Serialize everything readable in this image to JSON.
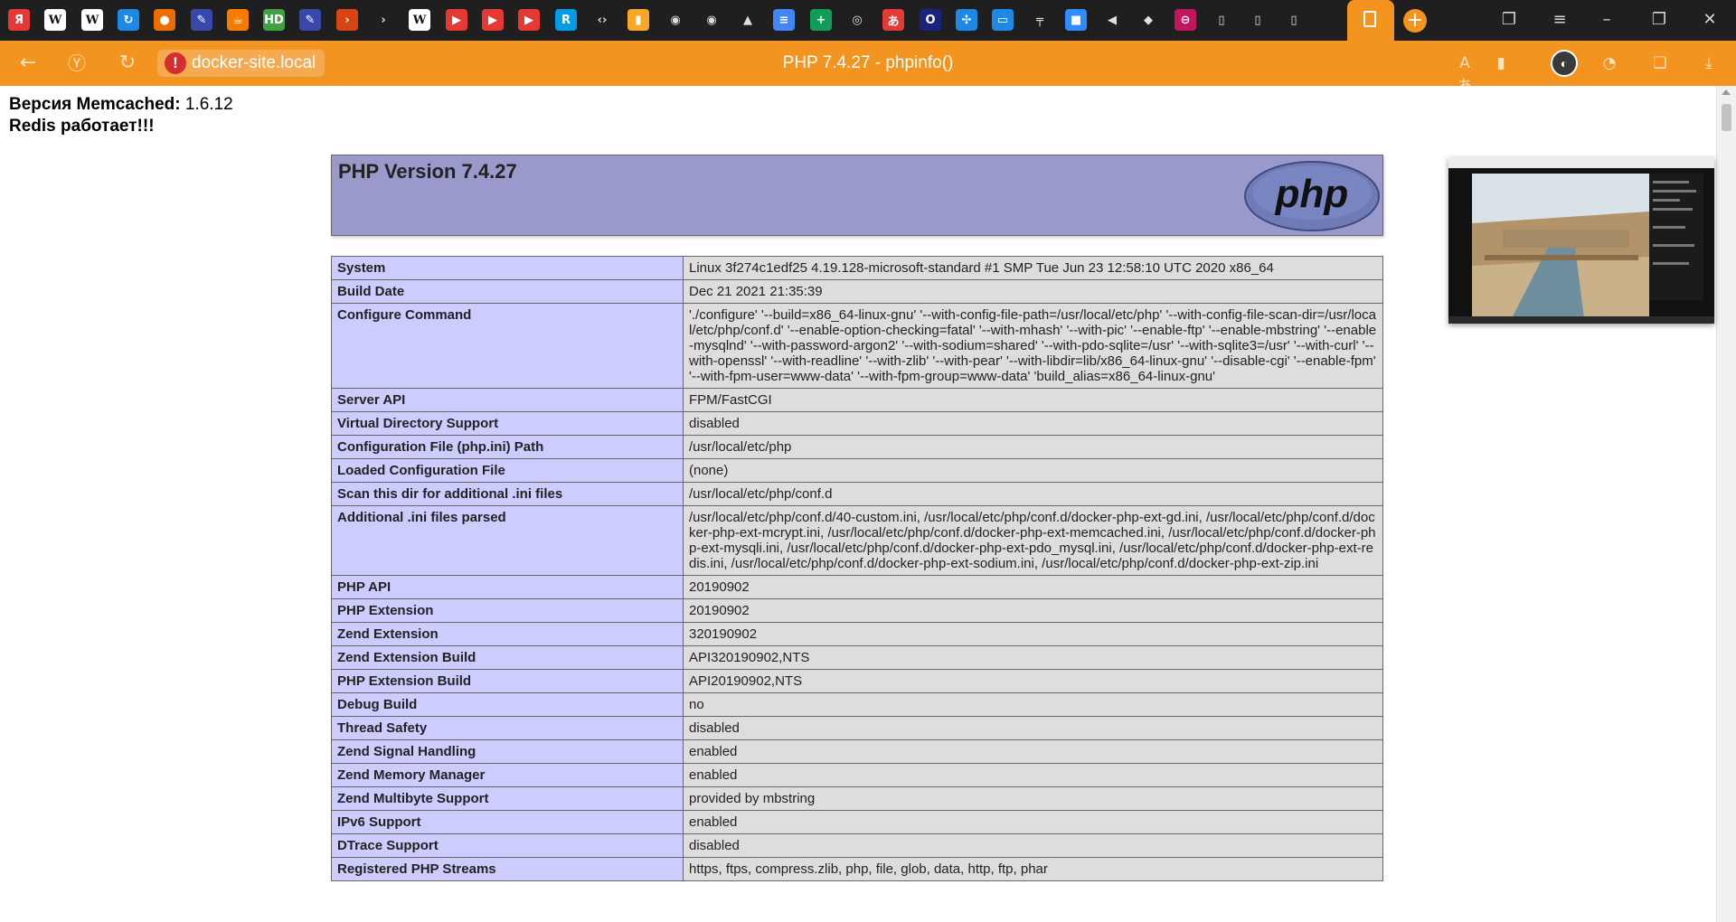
{
  "browser": {
    "tab_icons": [
      {
        "icon": "yandex-icon",
        "bg": "#e53935",
        "glyph": "Я"
      },
      {
        "icon": "wikipedia-icon",
        "bg": "#ffffff",
        "glyph": "W"
      },
      {
        "icon": "wikipedia-icon",
        "bg": "#ffffff",
        "glyph": "W"
      },
      {
        "icon": "sync-icon",
        "bg": "#1e88e5",
        "glyph": "↻"
      },
      {
        "icon": "bookmark-icon",
        "bg": "#ef6c00",
        "glyph": "●"
      },
      {
        "icon": "image-icon",
        "bg": "#3949ab",
        "glyph": "✎"
      },
      {
        "icon": "java-icon",
        "bg": "#f57c00",
        "glyph": "☕"
      },
      {
        "icon": "hd-icon",
        "bg": "#43a047",
        "glyph": "HD"
      },
      {
        "icon": "image-icon",
        "bg": "#3949ab",
        "glyph": "✎"
      },
      {
        "icon": "powerpoint-icon",
        "bg": "#d84315",
        "glyph": "›"
      },
      {
        "icon": "arrow-icon",
        "bg": "#1f1f1f",
        "glyph": "›"
      },
      {
        "icon": "wikipedia-icon",
        "bg": "#ffffff",
        "glyph": "W"
      },
      {
        "icon": "youtube-icon",
        "bg": "#e53935",
        "glyph": "▶"
      },
      {
        "icon": "youtube-icon",
        "bg": "#e53935",
        "glyph": "▶"
      },
      {
        "icon": "youtube-icon",
        "bg": "#e53935",
        "glyph": "▶"
      },
      {
        "icon": "translate-icon",
        "bg": "#039be5",
        "glyph": "R"
      },
      {
        "icon": "code-icon",
        "bg": "#1f1f1f",
        "glyph": "‹›"
      },
      {
        "icon": "chart-icon",
        "bg": "#f9a825",
        "glyph": "▮"
      },
      {
        "icon": "github-icon",
        "bg": "#1f1f1f",
        "glyph": "◉"
      },
      {
        "icon": "github-icon",
        "bg": "#1f1f1f",
        "glyph": "◉"
      },
      {
        "icon": "google-drive-icon",
        "bg": "#1f1f1f",
        "glyph": "▲"
      },
      {
        "icon": "google-docs-icon",
        "bg": "#4285f4",
        "glyph": "≡"
      },
      {
        "icon": "google-sheets-icon",
        "bg": "#0f9d58",
        "glyph": "+"
      },
      {
        "icon": "chrome-icon",
        "bg": "#1f1f1f",
        "glyph": "◎"
      },
      {
        "icon": "translate-icon",
        "bg": "#e53935",
        "glyph": "あ"
      },
      {
        "icon": "opera-icon",
        "bg": "#1a237e",
        "glyph": "O"
      },
      {
        "icon": "network-icon",
        "bg": "#1e88e5",
        "glyph": "✣"
      },
      {
        "icon": "chat-icon",
        "bg": "#1e88e5",
        "glyph": "▭"
      },
      {
        "icon": "pin-icon",
        "bg": "#1f1f1f",
        "glyph": "╤"
      },
      {
        "icon": "zoom-icon",
        "bg": "#2d8cff",
        "glyph": "■"
      },
      {
        "icon": "speaker-icon",
        "bg": "#1f1f1f",
        "glyph": "◀"
      },
      {
        "icon": "gitlab-icon",
        "bg": "#1f1f1f",
        "glyph": "◆"
      },
      {
        "icon": "stop-icon",
        "bg": "#c2185b",
        "glyph": "⊖"
      },
      {
        "icon": "document-icon",
        "bg": "#1f1f1f",
        "glyph": "▯"
      },
      {
        "icon": "document-icon",
        "bg": "#1f1f1f",
        "glyph": "▯"
      },
      {
        "icon": "document-icon",
        "bg": "#1f1f1f",
        "glyph": "▯"
      }
    ],
    "url": "docker-site.local",
    "title": "PHP 7.4.27 - phpinfo()"
  },
  "page": {
    "memcached_label": "Версия Memcached:",
    "memcached_version": "1.6.12",
    "redis_status": "Redis работает!!!",
    "php_version": "PHP Version 7.4.27",
    "php_logo_text": "php",
    "rows": [
      {
        "key": "System",
        "value": "Linux 3f274c1edf25 4.19.128-microsoft-standard #1 SMP Tue Jun 23 12:58:10 UTC 2020 x86_64"
      },
      {
        "key": "Build Date",
        "value": "Dec 21 2021 21:35:39"
      },
      {
        "key": "Configure Command",
        "value": "'./configure' '--build=x86_64-linux-gnu' '--with-config-file-path=/usr/local/etc/php' '--with-config-file-scan-dir=/usr/local/etc/php/conf.d' '--enable-option-checking=fatal' '--with-mhash' '--with-pic' '--enable-ftp' '--enable-mbstring' '--enable-mysqlnd' '--with-password-argon2' '--with-sodium=shared' '--with-pdo-sqlite=/usr' '--with-sqlite3=/usr' '--with-curl' '--with-openssl' '--with-readline' '--with-zlib' '--with-pear' '--with-libdir=lib/x86_64-linux-gnu' '--disable-cgi' '--enable-fpm' '--with-fpm-user=www-data' '--with-fpm-group=www-data' 'build_alias=x86_64-linux-gnu'"
      },
      {
        "key": "Server API",
        "value": "FPM/FastCGI"
      },
      {
        "key": "Virtual Directory Support",
        "value": "disabled"
      },
      {
        "key": "Configuration File (php.ini) Path",
        "value": "/usr/local/etc/php"
      },
      {
        "key": "Loaded Configuration File",
        "value": "(none)"
      },
      {
        "key": "Scan this dir for additional .ini files",
        "value": "/usr/local/etc/php/conf.d"
      },
      {
        "key": "Additional .ini files parsed",
        "value": "/usr/local/etc/php/conf.d/40-custom.ini, /usr/local/etc/php/conf.d/docker-php-ext-gd.ini, /usr/local/etc/php/conf.d/docker-php-ext-mcrypt.ini, /usr/local/etc/php/conf.d/docker-php-ext-memcached.ini, /usr/local/etc/php/conf.d/docker-php-ext-mysqli.ini, /usr/local/etc/php/conf.d/docker-php-ext-pdo_mysql.ini, /usr/local/etc/php/conf.d/docker-php-ext-redis.ini, /usr/local/etc/php/conf.d/docker-php-ext-sodium.ini, /usr/local/etc/php/conf.d/docker-php-ext-zip.ini"
      },
      {
        "key": "PHP API",
        "value": "20190902"
      },
      {
        "key": "PHP Extension",
        "value": "20190902"
      },
      {
        "key": "Zend Extension",
        "value": "320190902"
      },
      {
        "key": "Zend Extension Build",
        "value": "API320190902,NTS"
      },
      {
        "key": "PHP Extension Build",
        "value": "API20190902,NTS"
      },
      {
        "key": "Debug Build",
        "value": "no"
      },
      {
        "key": "Thread Safety",
        "value": "disabled"
      },
      {
        "key": "Zend Signal Handling",
        "value": "enabled"
      },
      {
        "key": "Zend Memory Manager",
        "value": "enabled"
      },
      {
        "key": "Zend Multibyte Support",
        "value": "provided by mbstring"
      },
      {
        "key": "IPv6 Support",
        "value": "enabled"
      },
      {
        "key": "DTrace Support",
        "value": "disabled"
      },
      {
        "key": "Registered PHP Streams",
        "value": "https, ftps, compress.zlib, php, file, glob, data, http, ftp, phar"
      }
    ]
  },
  "colors": {
    "accent": "#f39320",
    "tabstrip_bg": "#1f1f1f",
    "php_header_bg": "#9999cc",
    "key_cell_bg": "#ccccff",
    "value_cell_bg": "#dddddd"
  }
}
